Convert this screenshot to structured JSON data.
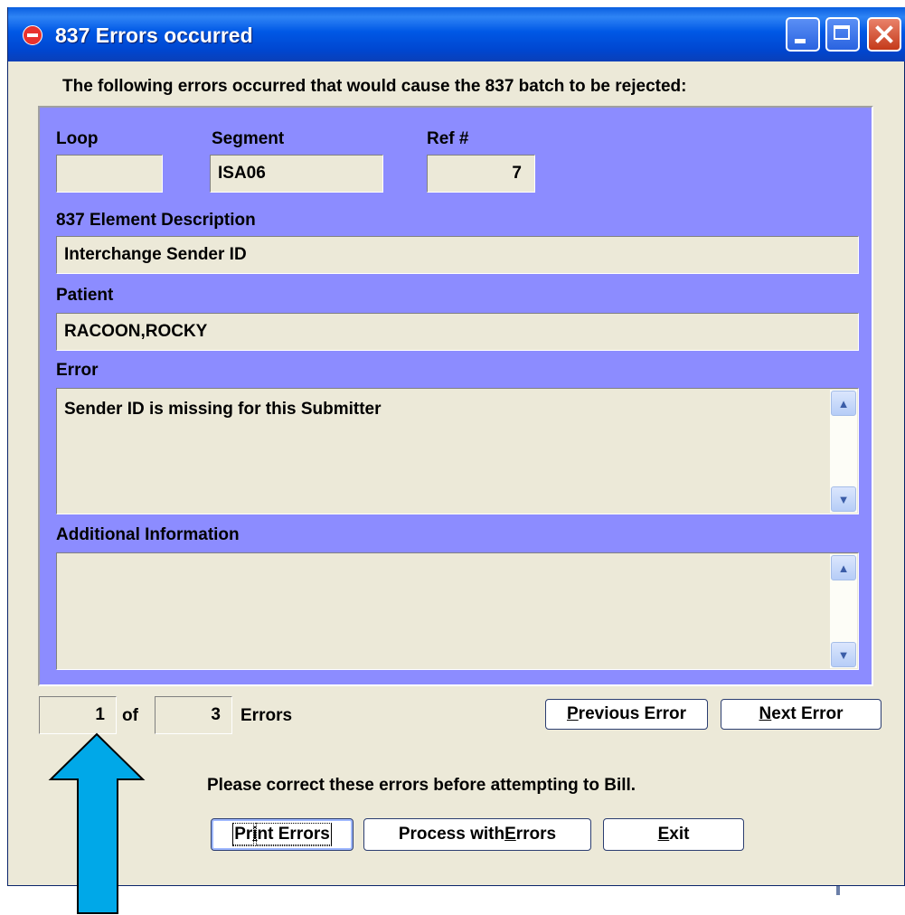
{
  "window": {
    "title": "837 Errors occurred",
    "header_message": "The following errors occurred that would cause the 837 batch to be rejected:"
  },
  "fields": {
    "loop": {
      "label": "Loop",
      "value": ""
    },
    "segment": {
      "label": "Segment",
      "value": "ISA06"
    },
    "ref": {
      "label": "Ref #",
      "value": "7"
    },
    "element_description": {
      "label": "837 Element Description",
      "value": "Interchange Sender ID"
    },
    "patient": {
      "label": "Patient",
      "value": "RACOON,ROCKY"
    },
    "error": {
      "label": "Error",
      "value": "Sender  ID is missing for this Submitter"
    },
    "additional_info": {
      "label": "Additional Information",
      "value": ""
    }
  },
  "pager": {
    "current": "1",
    "of_label": "of",
    "total": "3",
    "errors_label": "Errors"
  },
  "buttons": {
    "previous": {
      "prefix": "",
      "mnemonic": "P",
      "suffix": "revious Error"
    },
    "next": {
      "prefix": "",
      "mnemonic": "N",
      "suffix": "ext Error"
    },
    "print": {
      "prefix": "Pr",
      "mnemonic": "i",
      "suffix": "nt Errors"
    },
    "process": {
      "prefix": "Process with ",
      "mnemonic": "E",
      "suffix": "rrors"
    },
    "exit": {
      "prefix": "",
      "mnemonic": "E",
      "suffix": "xit"
    }
  },
  "notice": "Please correct these errors before attempting to Bill.",
  "colors": {
    "panel": "#8c8cff",
    "dialog": "#ece9d8",
    "arrow": "#00a8e8"
  }
}
